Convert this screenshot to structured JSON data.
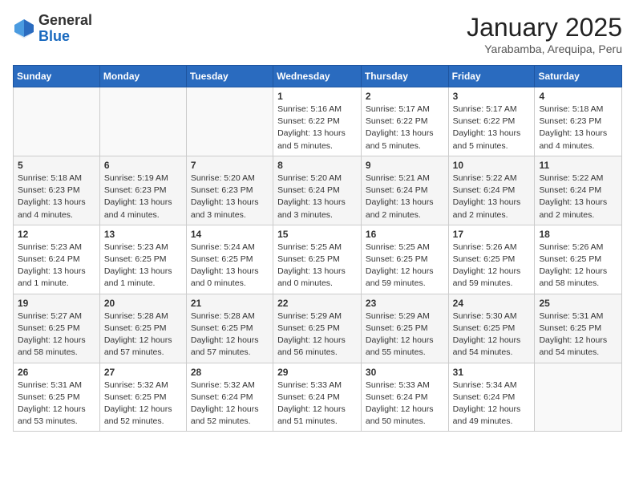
{
  "header": {
    "logo_general": "General",
    "logo_blue": "Blue",
    "month": "January 2025",
    "location": "Yarabamba, Arequipa, Peru"
  },
  "weekdays": [
    "Sunday",
    "Monday",
    "Tuesday",
    "Wednesday",
    "Thursday",
    "Friday",
    "Saturday"
  ],
  "weeks": [
    [
      {
        "day": "",
        "info": ""
      },
      {
        "day": "",
        "info": ""
      },
      {
        "day": "",
        "info": ""
      },
      {
        "day": "1",
        "info": "Sunrise: 5:16 AM\nSunset: 6:22 PM\nDaylight: 13 hours\nand 5 minutes."
      },
      {
        "day": "2",
        "info": "Sunrise: 5:17 AM\nSunset: 6:22 PM\nDaylight: 13 hours\nand 5 minutes."
      },
      {
        "day": "3",
        "info": "Sunrise: 5:17 AM\nSunset: 6:22 PM\nDaylight: 13 hours\nand 5 minutes."
      },
      {
        "day": "4",
        "info": "Sunrise: 5:18 AM\nSunset: 6:23 PM\nDaylight: 13 hours\nand 4 minutes."
      }
    ],
    [
      {
        "day": "5",
        "info": "Sunrise: 5:18 AM\nSunset: 6:23 PM\nDaylight: 13 hours\nand 4 minutes."
      },
      {
        "day": "6",
        "info": "Sunrise: 5:19 AM\nSunset: 6:23 PM\nDaylight: 13 hours\nand 4 minutes."
      },
      {
        "day": "7",
        "info": "Sunrise: 5:20 AM\nSunset: 6:23 PM\nDaylight: 13 hours\nand 3 minutes."
      },
      {
        "day": "8",
        "info": "Sunrise: 5:20 AM\nSunset: 6:24 PM\nDaylight: 13 hours\nand 3 minutes."
      },
      {
        "day": "9",
        "info": "Sunrise: 5:21 AM\nSunset: 6:24 PM\nDaylight: 13 hours\nand 2 minutes."
      },
      {
        "day": "10",
        "info": "Sunrise: 5:22 AM\nSunset: 6:24 PM\nDaylight: 13 hours\nand 2 minutes."
      },
      {
        "day": "11",
        "info": "Sunrise: 5:22 AM\nSunset: 6:24 PM\nDaylight: 13 hours\nand 2 minutes."
      }
    ],
    [
      {
        "day": "12",
        "info": "Sunrise: 5:23 AM\nSunset: 6:24 PM\nDaylight: 13 hours\nand 1 minute."
      },
      {
        "day": "13",
        "info": "Sunrise: 5:23 AM\nSunset: 6:25 PM\nDaylight: 13 hours\nand 1 minute."
      },
      {
        "day": "14",
        "info": "Sunrise: 5:24 AM\nSunset: 6:25 PM\nDaylight: 13 hours\nand 0 minutes."
      },
      {
        "day": "15",
        "info": "Sunrise: 5:25 AM\nSunset: 6:25 PM\nDaylight: 13 hours\nand 0 minutes."
      },
      {
        "day": "16",
        "info": "Sunrise: 5:25 AM\nSunset: 6:25 PM\nDaylight: 12 hours\nand 59 minutes."
      },
      {
        "day": "17",
        "info": "Sunrise: 5:26 AM\nSunset: 6:25 PM\nDaylight: 12 hours\nand 59 minutes."
      },
      {
        "day": "18",
        "info": "Sunrise: 5:26 AM\nSunset: 6:25 PM\nDaylight: 12 hours\nand 58 minutes."
      }
    ],
    [
      {
        "day": "19",
        "info": "Sunrise: 5:27 AM\nSunset: 6:25 PM\nDaylight: 12 hours\nand 58 minutes."
      },
      {
        "day": "20",
        "info": "Sunrise: 5:28 AM\nSunset: 6:25 PM\nDaylight: 12 hours\nand 57 minutes."
      },
      {
        "day": "21",
        "info": "Sunrise: 5:28 AM\nSunset: 6:25 PM\nDaylight: 12 hours\nand 57 minutes."
      },
      {
        "day": "22",
        "info": "Sunrise: 5:29 AM\nSunset: 6:25 PM\nDaylight: 12 hours\nand 56 minutes."
      },
      {
        "day": "23",
        "info": "Sunrise: 5:29 AM\nSunset: 6:25 PM\nDaylight: 12 hours\nand 55 minutes."
      },
      {
        "day": "24",
        "info": "Sunrise: 5:30 AM\nSunset: 6:25 PM\nDaylight: 12 hours\nand 54 minutes."
      },
      {
        "day": "25",
        "info": "Sunrise: 5:31 AM\nSunset: 6:25 PM\nDaylight: 12 hours\nand 54 minutes."
      }
    ],
    [
      {
        "day": "26",
        "info": "Sunrise: 5:31 AM\nSunset: 6:25 PM\nDaylight: 12 hours\nand 53 minutes."
      },
      {
        "day": "27",
        "info": "Sunrise: 5:32 AM\nSunset: 6:25 PM\nDaylight: 12 hours\nand 52 minutes."
      },
      {
        "day": "28",
        "info": "Sunrise: 5:32 AM\nSunset: 6:24 PM\nDaylight: 12 hours\nand 52 minutes."
      },
      {
        "day": "29",
        "info": "Sunrise: 5:33 AM\nSunset: 6:24 PM\nDaylight: 12 hours\nand 51 minutes."
      },
      {
        "day": "30",
        "info": "Sunrise: 5:33 AM\nSunset: 6:24 PM\nDaylight: 12 hours\nand 50 minutes."
      },
      {
        "day": "31",
        "info": "Sunrise: 5:34 AM\nSunset: 6:24 PM\nDaylight: 12 hours\nand 49 minutes."
      },
      {
        "day": "",
        "info": ""
      }
    ]
  ]
}
